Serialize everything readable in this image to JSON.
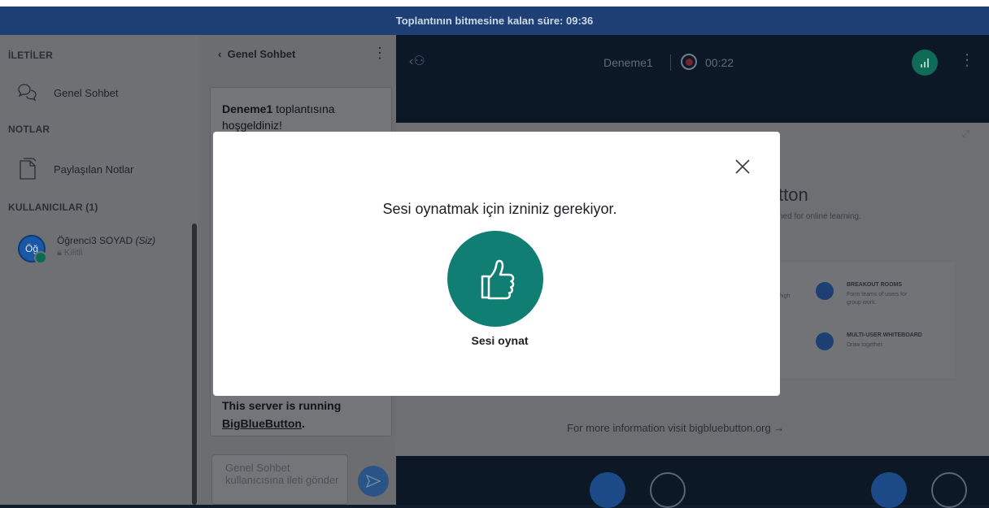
{
  "timer": {
    "text": "Toplantının bitmesine kalan süre: 09:36"
  },
  "sidebar": {
    "messages_header": "İLETİLER",
    "public_chat": "Genel Sohbet",
    "notes_header": "NOTLAR",
    "shared_notes": "Paylaşılan Notlar",
    "users_header": "KULLANICILAR (1)",
    "user": {
      "initials": "Öğ",
      "name": "Öğrenci3 SOYAD",
      "you_tag": "(Siz)",
      "status": "Kilitli"
    }
  },
  "chat": {
    "title": "Genel Sohbet",
    "welcome_bold": "Deneme1",
    "welcome_rest": " toplantısına hoşgeldiniz!",
    "bottom_prefix": "This server is running",
    "bottom_link": "BigBlueButton",
    "input_placeholder": "Genel Sohbet kullanıcısına ileti gönder"
  },
  "main": {
    "meeting_name": "Deneme1",
    "record_time": "00:22"
  },
  "presentation": {
    "partial_title": "tton",
    "partial_subtitle": "ned for online learning.",
    "features": [
      {
        "title": "BREAKOUT ROOMS",
        "desc": "Form teams of users for group work."
      },
      {
        "title": "MULTI-USER WHITEBOARD",
        "desc": "Draw together."
      }
    ],
    "partial_left_1": "ing high",
    "partial_left_2": "G",
    "partial_left_3": "n.",
    "more_info": "For more information visit bigbluebutton.org →"
  },
  "modal": {
    "title": "Sesi oynatmak için izniniz gerekiyor.",
    "play_label": "Sesi oynat"
  },
  "colors": {
    "modal_button": "#117e74",
    "timer_bar": "#1d3f74",
    "primary": "#1c4a86"
  },
  "icons": {
    "chat": "chat-bubbles-icon",
    "notes": "note-icon",
    "play": "thumbs-up-icon",
    "close": "close-icon"
  }
}
